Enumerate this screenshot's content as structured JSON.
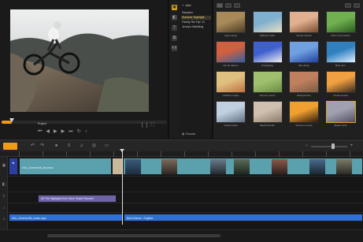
{
  "preview": {
    "project_label": "Project",
    "scrub_position": 0.06,
    "controls": [
      "previous-icon",
      "rewind-icon",
      "play-icon",
      "forward-icon",
      "next-icon",
      "repeat-icon",
      "volume-icon"
    ],
    "right_controls": [
      "mark-in-icon",
      "mark-out-icon",
      "fullscreen-icon"
    ]
  },
  "library": {
    "add_label": "Add",
    "folders": [
      "Samples",
      "Summer Highlight",
      "Family Ski Trip '11",
      "Jenny's Wedding"
    ],
    "active_folder_index": 1,
    "browse_label": "Browse",
    "thumbnail_captions": [
      "Lake sunset",
      "Sailboat cruise",
      "Family portrait",
      "Kids on the beach",
      "Hot air balloon",
      "Parasailing",
      "Sky diving",
      "Blue river",
      "Children's party",
      "Summer picnic",
      "Backyard fun",
      "Ocean sunset",
      "Yacht marina",
      "Beach friends",
      "Summer sunset",
      "Beach stroll"
    ],
    "selected_thumb_index": 15
  },
  "timeline": {
    "zoom_level": 0.6,
    "playhead_position": 0.344,
    "tracks": {
      "video_clip_label": "HAL_General 86_Bunnies",
      "overlay_clip_label": "All The Highlights from Dave Grand Summer",
      "music_track_1": "HAL_General 86_music.mpa",
      "music_track_2": "Birch Dance - Fugitive"
    }
  },
  "colors": {
    "accent": "#f09a1a",
    "video_clip": "#5aa0ad",
    "overlay_clip": "#6d64a8",
    "music_clip": "#2f6fd8",
    "selection": "#d8a020"
  }
}
